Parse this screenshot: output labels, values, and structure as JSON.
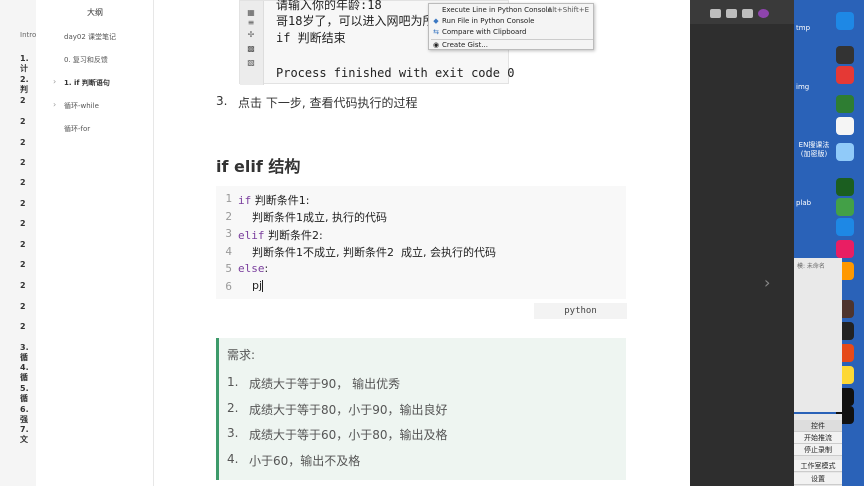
{
  "left_strip": {
    "intro": "Intro",
    "numbers": [
      "1. 计",
      "2. 判",
      "2",
      "2",
      "2",
      "2",
      "2",
      "2",
      "2",
      "2",
      "2",
      "2",
      "2",
      "2",
      "3. 循",
      "4. 循",
      "5. 循",
      "6. 强",
      "7. 文"
    ]
  },
  "sidebar": {
    "title": "大纲",
    "items": [
      {
        "label": "day02 课堂笔记",
        "chevron": false,
        "active": false
      },
      {
        "label": "0. 复习和反馈",
        "chevron": false,
        "active": false
      },
      {
        "label": "1. if 判断语句",
        "chevron": true,
        "active": true
      },
      {
        "label": "循环-while",
        "chevron": true,
        "active": false
      },
      {
        "label": "循环-for",
        "chevron": false,
        "active": false
      }
    ]
  },
  "screenshot": {
    "lines": [
      "请输入你的年龄:18",
      "哥18岁了，可以进入网吧为所",
      "if 判断结束",
      "Process finished with exit code 0"
    ],
    "context_menu": [
      {
        "label": "Execute Line in Python Console",
        "shortcut": "Alt+Shift+E",
        "icon": ""
      },
      {
        "label": "Run File in Python Console",
        "shortcut": "",
        "icon": "python-icon"
      },
      {
        "label": "Compare with Clipboard",
        "shortcut": "",
        "icon": "compare-icon"
      },
      {
        "label": "Create Gist...",
        "shortcut": "",
        "icon": "github-icon"
      }
    ]
  },
  "step3": {
    "number": "3.",
    "text": "点击 下一步, 查看代码执行的过程"
  },
  "heading": "if elif 结构",
  "code": {
    "language": "python",
    "line_numbers": [
      "1",
      "2",
      "3",
      "4",
      "5",
      "6"
    ],
    "lines": [
      {
        "kw": "if",
        "text": " 判断条件1:"
      },
      {
        "kw": "",
        "text": "    判断条件1成立, 执行的代码"
      },
      {
        "kw": "elif",
        "text": " 判断条件2:"
      },
      {
        "kw": "",
        "text": "    判断条件1不成立, 判断条件2  成立, 会执行的代码"
      },
      {
        "kw": "else",
        "text": ":"
      },
      {
        "kw": "",
        "text": "    pj"
      }
    ]
  },
  "requirement": {
    "title": "需求:",
    "items": [
      {
        "number": "1.",
        "text": "成绩大于等于90， 输出优秀"
      },
      {
        "number": "2.",
        "text": "成绩大于等于80，小于90，输出良好"
      },
      {
        "number": "3.",
        "text": "成绩大于等于60，小于80，输出及格"
      },
      {
        "number": "4.",
        "text": "小于60，输出不及格"
      }
    ]
  },
  "desktop": {
    "labels": [
      "tmp",
      "img",
      "EN搜课法\n(加密版)",
      "plab",
      "控件",
      "开始推流",
      "停止录制",
      "工作室模式",
      "设置"
    ],
    "mini_text": "模: 未命名"
  },
  "colors": {
    "accent": "#3d9a6a",
    "keyword": "#7a3e9d",
    "desktop_bg": "#2a62b8"
  }
}
